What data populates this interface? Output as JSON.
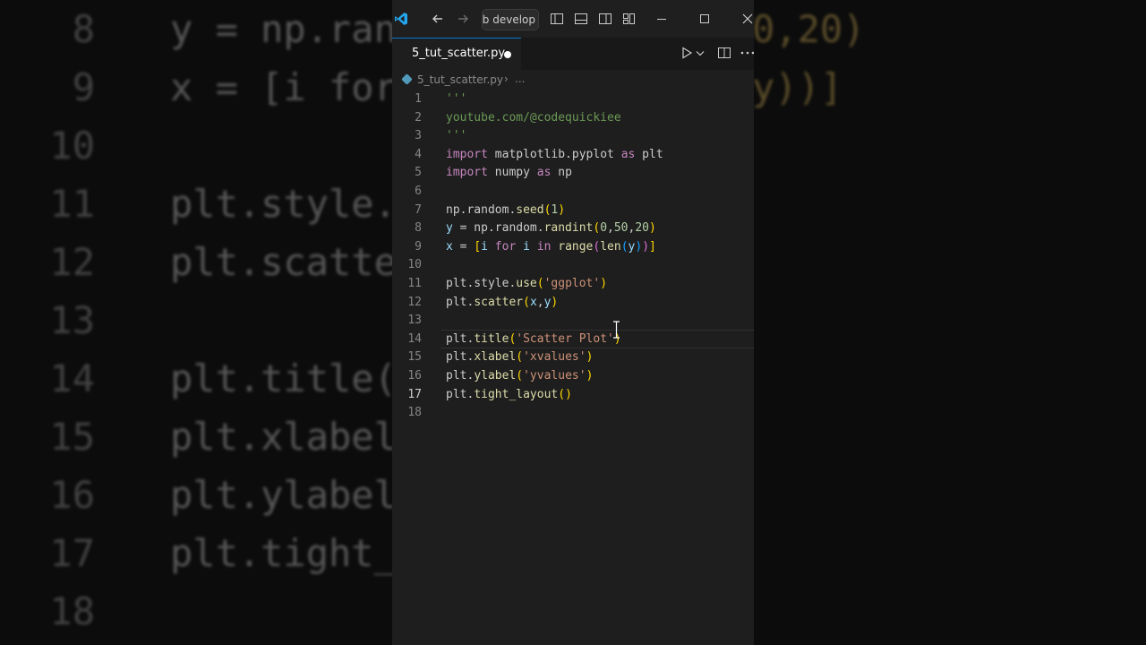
{
  "background": {
    "rows": [
      {
        "num": "8",
        "code": "y = np.ran",
        "right": "0,20)"
      },
      {
        "num": "9",
        "code": "x = [i for",
        "right": "y))]"
      },
      {
        "num": "10",
        "code": "",
        "right": ""
      },
      {
        "num": "11",
        "code": "plt.style.",
        "right": ""
      },
      {
        "num": "12",
        "code": "plt.scatte",
        "right": ""
      },
      {
        "num": "13",
        "code": "",
        "right": ""
      },
      {
        "num": "14",
        "code": "plt.title(",
        "right": ""
      },
      {
        "num": "15",
        "code": "plt.xlabel",
        "right": ""
      },
      {
        "num": "16",
        "code": "plt.ylabel",
        "right": ""
      },
      {
        "num": "17",
        "code": "plt.tight_",
        "right": ""
      },
      {
        "num": "18",
        "code": "",
        "right": ""
      }
    ]
  },
  "titlebar": {
    "search_text": "eb develop",
    "icons": [
      "vscode-logo-icon",
      "back-arrow-icon",
      "forward-arrow-icon",
      "toggle-primary-sidebar-icon",
      "toggle-panel-icon",
      "toggle-secondary-sidebar-icon",
      "customize-layout-icon",
      "minimize-icon",
      "maximize-icon",
      "close-icon"
    ]
  },
  "tab": {
    "label": "5_tut_scatter.py",
    "modified": true
  },
  "breadcrumb": {
    "file": "5_tut_scatter.py",
    "separator": "›",
    "more": "..."
  },
  "editor": {
    "active_line": 17,
    "highlighted_line": 14,
    "lines": [
      {
        "n": "1",
        "t": "'''"
      },
      {
        "n": "2",
        "t": "youtube.com/@codequickiee"
      },
      {
        "n": "3",
        "t": "'''"
      },
      {
        "n": "4",
        "t": "import matplotlib.pyplot as plt"
      },
      {
        "n": "5",
        "t": "import numpy as np"
      },
      {
        "n": "6",
        "t": ""
      },
      {
        "n": "7",
        "t": "np.random.seed(1)"
      },
      {
        "n": "8",
        "t": "y = np.random.randint(0,50,20)"
      },
      {
        "n": "9",
        "t": "x = [i for i in range(len(y))]"
      },
      {
        "n": "10",
        "t": ""
      },
      {
        "n": "11",
        "t": "plt.style.use('ggplot')"
      },
      {
        "n": "12",
        "t": "plt.scatter(x,y)"
      },
      {
        "n": "13",
        "t": ""
      },
      {
        "n": "14",
        "t": "plt.title('Scatter Plot')"
      },
      {
        "n": "15",
        "t": "plt.xlabel('xvalues')"
      },
      {
        "n": "16",
        "t": "plt.ylabel('yvalues')"
      },
      {
        "n": "17",
        "t": "plt.tight_layout()"
      },
      {
        "n": "18",
        "t": ""
      }
    ]
  },
  "colors": {
    "editor_bg": "#1e1e1e",
    "keyword": "#c586c0",
    "function": "#dcdcaa",
    "string": "#ce9178",
    "comment": "#6a9955",
    "number": "#b5cea8",
    "accent": "#0078d4"
  }
}
